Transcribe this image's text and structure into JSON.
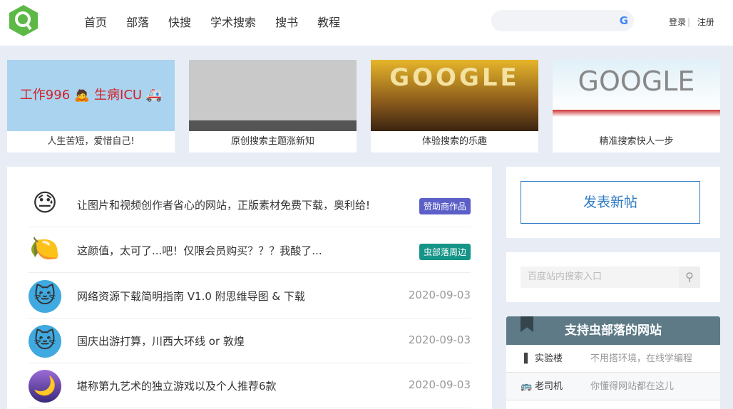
{
  "header": {
    "nav": [
      "首页",
      "部落",
      "快搜",
      "学术搜索",
      "搜书",
      "教程"
    ],
    "login": "登录",
    "register": "注册",
    "search_icon": "G"
  },
  "cards": [
    {
      "caption": "人生苦短，爱惜自己!",
      "image_text": "工作996 🙇  生病ICU 🚑"
    },
    {
      "caption": "原创搜索主题涨新知"
    },
    {
      "caption": "体验搜索的乐趣",
      "image_text": "GOOGLE"
    },
    {
      "caption": "精准搜索快人一步",
      "image_text": "GOOGLE"
    }
  ],
  "posts": [
    {
      "title": "让图片和视频创作者省心的网站，正版素材免费下载，奥利给!",
      "badge": "赞助商作品",
      "badge_color": "#5b5fc7",
      "avatar": "😓"
    },
    {
      "title": "这颜值，太可了...吧！仅限会员购买？？？我酸了...",
      "badge": "虫部落周边",
      "badge_color": "#159488",
      "avatar": "🍋"
    },
    {
      "title": "网络资源下载简明指南 V1.0 附思维导图 & 下载",
      "date": "2020-09-03",
      "avatar": "🐱"
    },
    {
      "title": "国庆出游打算，川西大环线 or 敦煌",
      "date": "2020-09-03",
      "avatar": "🐱"
    },
    {
      "title": "堪称第九艺术的独立游戏以及个人推荐6款",
      "date": "2020-09-03",
      "avatar": "🌙"
    }
  ],
  "sidebar": {
    "post_button": "发表新帖",
    "search_placeholder": "百度站内搜索入口",
    "support_title": "支持虫部落的网站",
    "links": [
      {
        "name": "实验楼",
        "desc": "不用搭环境，在线学编程",
        "icon": "▐"
      },
      {
        "name": "老司机",
        "desc": "你懂得网站都在这儿",
        "icon": "🚌"
      }
    ]
  }
}
